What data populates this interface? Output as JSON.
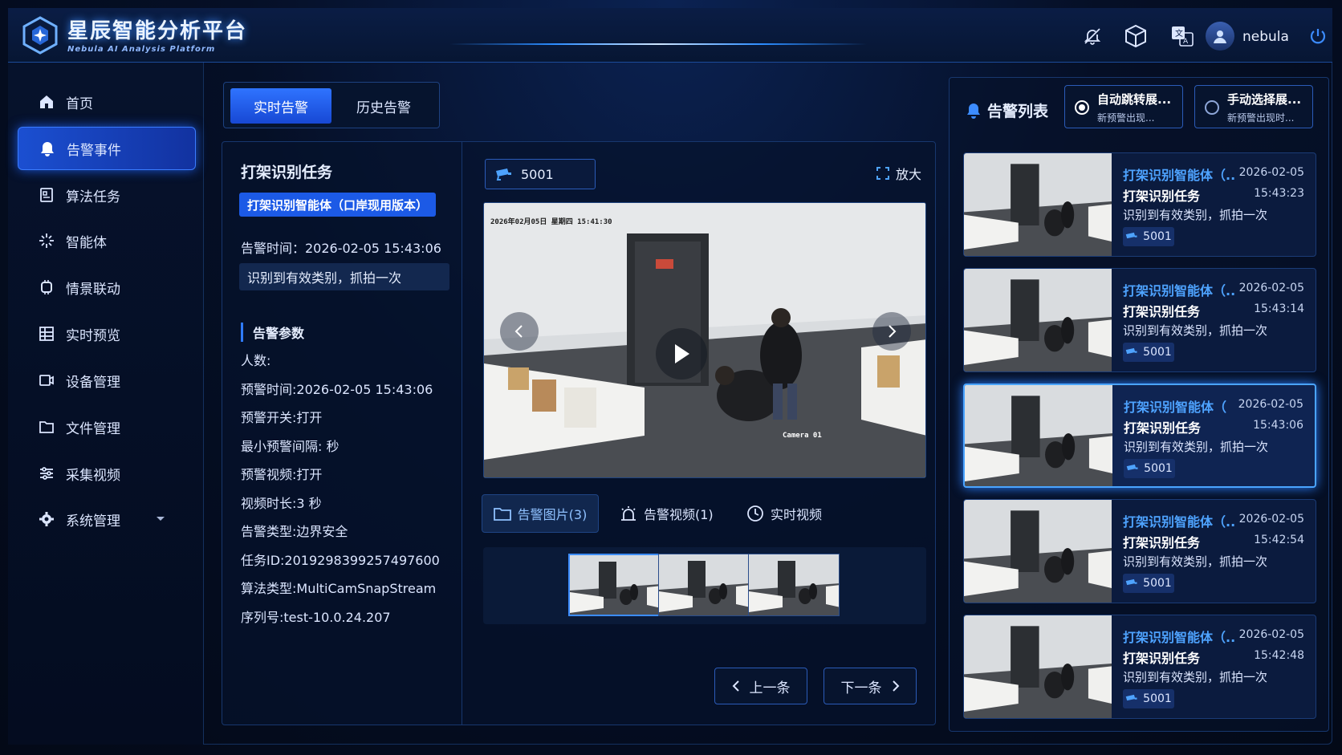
{
  "app": {
    "title": "星辰智能分析平台",
    "subtitle": "Nebula AI Analysis Platform",
    "user": "nebula"
  },
  "sidebar": {
    "items": [
      {
        "label": "首页",
        "icon": "home-icon",
        "active": false
      },
      {
        "label": "告警事件",
        "icon": "bell-icon",
        "active": true
      },
      {
        "label": "算法任务",
        "icon": "task-icon",
        "active": false
      },
      {
        "label": "智能体",
        "icon": "sparkle-icon",
        "active": false
      },
      {
        "label": "情景联动",
        "icon": "chip-icon",
        "active": false
      },
      {
        "label": "实时预览",
        "icon": "grid-icon",
        "active": false
      },
      {
        "label": "设备管理",
        "icon": "camera-icon",
        "active": false
      },
      {
        "label": "文件管理",
        "icon": "folder-icon",
        "active": false
      },
      {
        "label": "采集视频",
        "icon": "sliders-icon",
        "active": false
      },
      {
        "label": "系统管理",
        "icon": "gear-icon",
        "active": false
      }
    ]
  },
  "tabs": {
    "realtime": "实时告警",
    "history": "历史告警"
  },
  "detail": {
    "task_title": "打架识别任务",
    "agent": "打架识别智能体（口岸现用版本）",
    "alert_time": "告警时间：2026-02-05 15:43:06",
    "result": "识别到有效类别，抓拍一次",
    "params_title": "告警参数",
    "params": [
      "人数:",
      "预警时间:2026-02-05 15:43:06",
      "预警开关:打开",
      "最小预警间隔: 秒",
      "预警视频:打开",
      "视频时长:3 秒",
      "告警类型:边界安全",
      "任务ID:2019298399257497600",
      "算法类型:MultiCamSnapStream",
      "序列号:test-10.0.24.207"
    ]
  },
  "viewer": {
    "camera": "5001",
    "zoom": "放大",
    "overlay_time": "2026年02月05日  星期四  15:41:30",
    "overlay_cam": "Camera 01",
    "media_tabs": {
      "images": "告警图片(3)",
      "videos": "告警视频(1)",
      "live": "实时视频"
    },
    "prev": "上一条",
    "next": "下一条"
  },
  "alert_list": {
    "title": "告警列表",
    "mode_auto": {
      "title": "自动跳转展...",
      "desc": "新预警出现..."
    },
    "mode_manual": {
      "title": "手动选择展...",
      "desc": "新预警出现时..."
    },
    "items": [
      {
        "agent": "打架识别智能体（...",
        "date": "2026-02-05",
        "time": "15:43:23",
        "task": "打架识别任务",
        "result": "识别到有效类别，抓拍一次",
        "camera": "5001",
        "selected": false
      },
      {
        "agent": "打架识别智能体（...",
        "date": "2026-02-05",
        "time": "15:43:14",
        "task": "打架识别任务",
        "result": "识别到有效类别，抓拍一次",
        "camera": "5001",
        "selected": false
      },
      {
        "agent": "打架识别智能体（",
        "date": "2026-02-05",
        "time": "15:43:06",
        "task": "打架识别任务",
        "result": "识别到有效类别，抓拍一次",
        "camera": "5001",
        "selected": true
      },
      {
        "agent": "打架识别智能体（...",
        "date": "2026-02-05",
        "time": "15:42:54",
        "task": "打架识别任务",
        "result": "识别到有效类别，抓拍一次",
        "camera": "5001",
        "selected": false
      },
      {
        "agent": "打架识别智能体（...",
        "date": "2026-02-05",
        "time": "15:42:48",
        "task": "打架识别任务",
        "result": "识别到有效类别，抓拍一次",
        "camera": "5001",
        "selected": false
      }
    ]
  }
}
